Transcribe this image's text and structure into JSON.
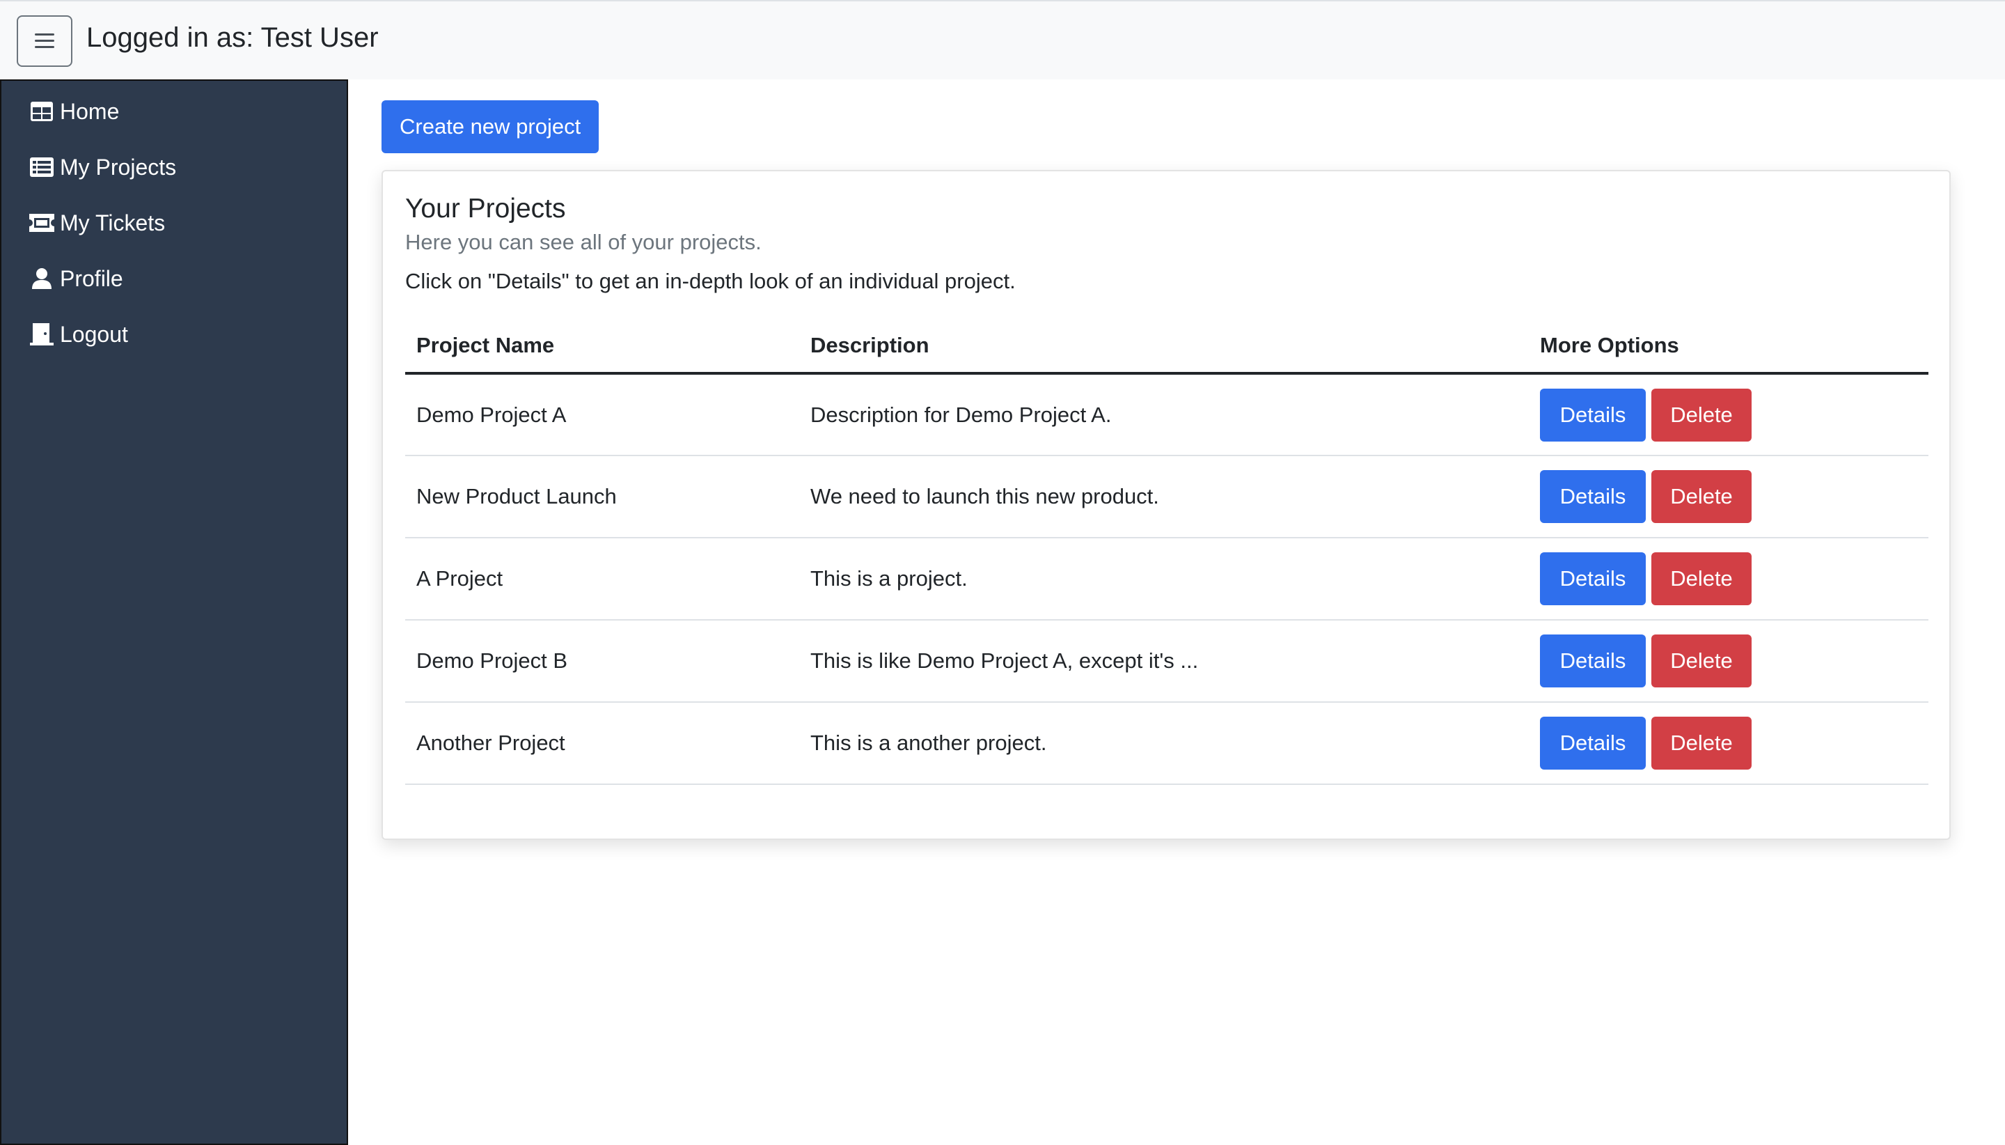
{
  "header": {
    "logged_in_text": "Logged in as: Test User",
    "menu_icon": "hamburger-icon"
  },
  "sidebar": {
    "items": [
      {
        "label": "Home",
        "icon": "table-icon"
      },
      {
        "label": "My Projects",
        "icon": "list-icon"
      },
      {
        "label": "My Tickets",
        "icon": "ticket-icon"
      },
      {
        "label": "Profile",
        "icon": "person-icon"
      },
      {
        "label": "Logout",
        "icon": "door-icon"
      }
    ]
  },
  "main": {
    "create_button_label": "Create new project",
    "card": {
      "title": "Your Projects",
      "subtitle": "Here you can see all of your projects.",
      "text": "Click on \"Details\" to get an in-depth look of an individual project."
    },
    "table": {
      "columns": [
        "Project Name",
        "Description",
        "More Options"
      ],
      "rows": [
        {
          "name": "Demo Project A",
          "description": "Description for Demo Project A."
        },
        {
          "name": "New Product Launch",
          "description": "We need to launch this new product."
        },
        {
          "name": "A Project",
          "description": "This is a project."
        },
        {
          "name": "Demo Project B",
          "description": "This is like Demo Project A, except it's ..."
        },
        {
          "name": "Another Project",
          "description": "This is a another project."
        }
      ],
      "details_label": "Details",
      "delete_label": "Delete"
    }
  },
  "colors": {
    "primary": "#2f6fed",
    "danger": "#d23f45",
    "sidebar_bg": "#2d3a4d",
    "topbar_bg": "#f8f9fa"
  }
}
